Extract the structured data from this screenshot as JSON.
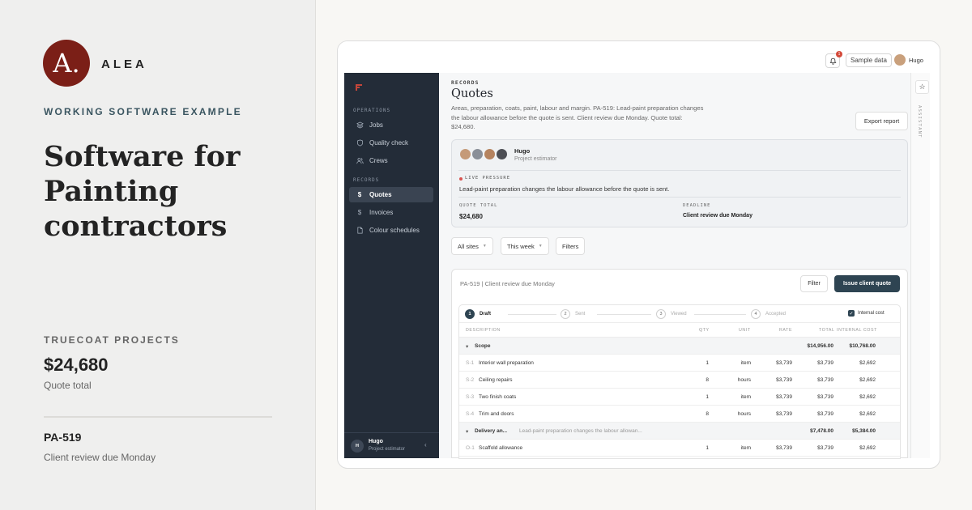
{
  "brand": {
    "logo_letter": "A.",
    "name": "ALEA",
    "logo_color": "#7b1f17"
  },
  "left": {
    "eyebrow": "WORKING SOFTWARE EXAMPLE",
    "headline": "Software for Painting contractors",
    "company": "TRUECOAT PROJECTS",
    "quote_total": "$24,680",
    "quote_total_label": "Quote total",
    "reference": "PA-519",
    "reference_sub": "Client review due Monday"
  },
  "topbar": {
    "notification_count": "1",
    "sample_data": "Sample data",
    "user_name": "Hugo"
  },
  "sidebar": {
    "section_operations": "OPERATIONS",
    "operations": [
      {
        "label": "Jobs",
        "icon": "layers-icon"
      },
      {
        "label": "Quality check",
        "icon": "shield-icon"
      },
      {
        "label": "Crews",
        "icon": "users-icon"
      }
    ],
    "section_records": "RECORDS",
    "records": [
      {
        "label": "Quotes",
        "icon": "dollar-icon",
        "active": true
      },
      {
        "label": "Invoices",
        "icon": "dollar-icon"
      },
      {
        "label": "Colour schedules",
        "icon": "document-icon"
      }
    ],
    "footer": {
      "initial": "H",
      "name": "Hugo",
      "role": "Project estimator"
    }
  },
  "assistant_label": "ASSISTANT",
  "page": {
    "crumb": "RECORDS",
    "title": "Quotes",
    "description": "Areas, preparation, coats, paint, labour and margin. PA-519: Lead-paint preparation changes the labour allowance before the quote is sent. Client review due Monday. Quote total: $24,680.",
    "export_button": "Export report"
  },
  "card": {
    "name": "Hugo",
    "role": "Project estimator",
    "live_label": "LIVE PRESSURE",
    "live_text": "Lead-paint preparation changes the labour allowance before the quote is sent.",
    "quote_total_label": "QUOTE TOTAL",
    "quote_total": "$24,680",
    "deadline_label": "DEADLINE",
    "deadline": "Client review due Monday"
  },
  "filters": {
    "sites": "All sites",
    "period": "This week",
    "filters": "Filters"
  },
  "quote_panel": {
    "header": "PA-519 | Client review due Monday",
    "filter_button": "Filter",
    "issue_button": "Issue client quote",
    "steps": [
      {
        "num": "1",
        "label": "Draft"
      },
      {
        "num": "2",
        "label": "Sent"
      },
      {
        "num": "3",
        "label": "Viewed"
      },
      {
        "num": "4",
        "label": "Accepted"
      }
    ],
    "internal_cost_label": "Internal cost",
    "columns": [
      "DESCRIPTION",
      "QTY",
      "UNIT",
      "RATE",
      "TOTAL",
      "INTERNAL COST"
    ],
    "groups": [
      {
        "name": "Scope",
        "note": "",
        "total": "$14,956.00",
        "internal": "$10,768.00",
        "rows": [
          {
            "code": "S-1",
            "desc": "Interior wall preparation",
            "qty": "1",
            "unit": "item",
            "rate": "$3,739",
            "total": "$3,739",
            "internal": "$2,692"
          },
          {
            "code": "S-2",
            "desc": "Ceiling repairs",
            "qty": "8",
            "unit": "hours",
            "rate": "$3,739",
            "total": "$3,739",
            "internal": "$2,692"
          },
          {
            "code": "S-3",
            "desc": "Two finish coats",
            "qty": "1",
            "unit": "item",
            "rate": "$3,739",
            "total": "$3,739",
            "internal": "$2,692"
          },
          {
            "code": "S-4",
            "desc": "Trim and doors",
            "qty": "8",
            "unit": "hours",
            "rate": "$3,739",
            "total": "$3,739",
            "internal": "$2,692"
          }
        ]
      },
      {
        "name": "Delivery an...",
        "note": "Lead-paint preparation changes the labour allowan...",
        "total": "$7,478.00",
        "internal": "$5,384.00",
        "rows": [
          {
            "code": "O-1",
            "desc": "Scaffold allowance",
            "qty": "1",
            "unit": "item",
            "rate": "$3,739",
            "total": "$3,739",
            "internal": "$2,692"
          }
        ]
      }
    ]
  },
  "colors": {
    "sidebar_bg": "#232c38",
    "primary_button": "#2e4452",
    "live_dot": "#d9534f"
  }
}
